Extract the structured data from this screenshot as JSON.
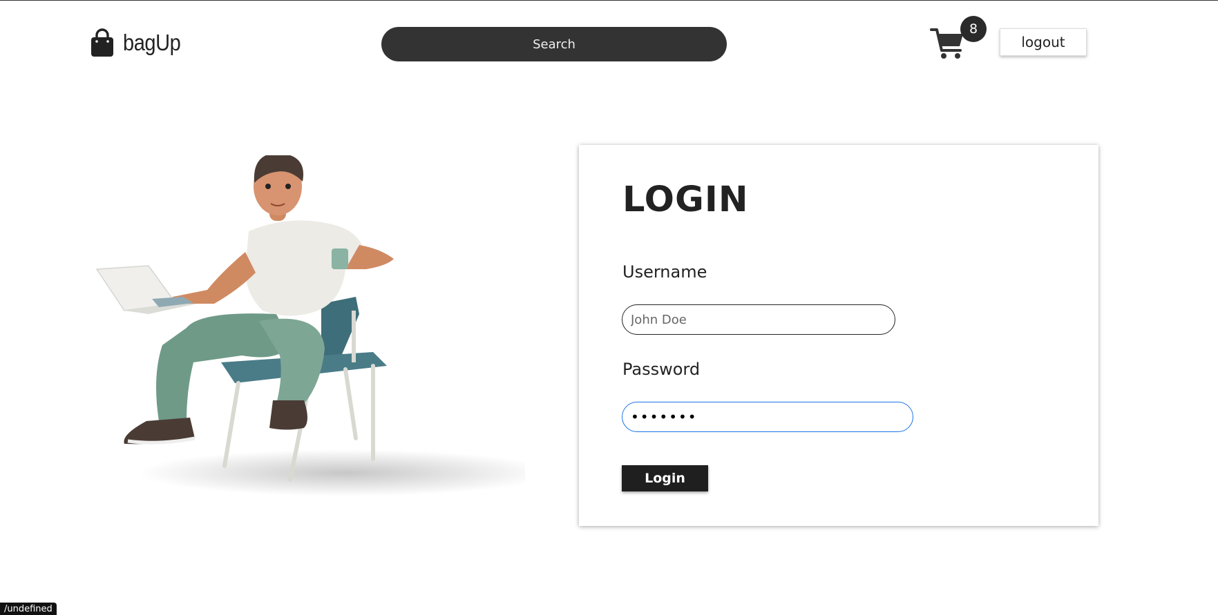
{
  "header": {
    "brand": "bagUp",
    "brand_icon": "shopping-bag-icon",
    "search_placeholder": "Search",
    "cart_icon": "shopping-cart-icon",
    "cart_count": "8",
    "logout_label": "logout"
  },
  "login": {
    "title": "LOGIN",
    "username_label": "Username",
    "username_placeholder": "John Doe",
    "password_label": "Password",
    "password_value": "•••••••",
    "submit_label": "Login"
  },
  "status": {
    "tooltip": "/undefined"
  },
  "colors": {
    "dark": "#333333",
    "badge": "#2a2a2a",
    "button": "#1f1f1f",
    "focus_border": "#1a73e8"
  }
}
